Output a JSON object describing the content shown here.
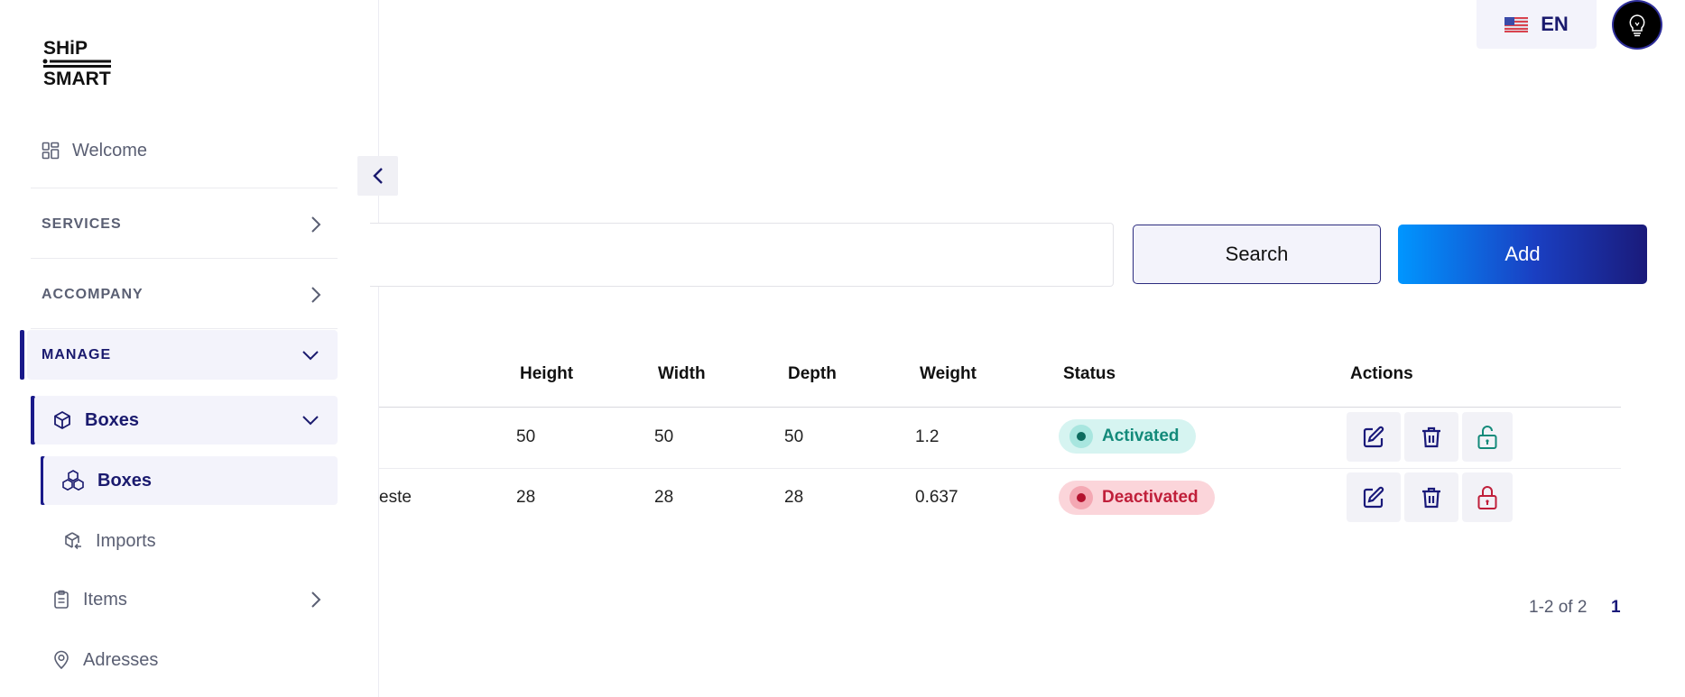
{
  "header": {
    "language": "EN",
    "language_flag": "us-flag-icon",
    "avatar_icon": "lightbulb-icon"
  },
  "sidebar": {
    "logo_text_top": "SHiP",
    "logo_text_bottom": "SMART",
    "welcome": "Welcome",
    "sections": {
      "services": "SERVICES",
      "accompany": "ACCOMPANY",
      "manage": "MANAGE"
    },
    "manage_items": {
      "boxes_parent": "Boxes",
      "boxes_child": "Boxes",
      "imports": "Imports",
      "items": "Items",
      "adresses": "Adresses"
    }
  },
  "toolbar": {
    "search_placeholder": "",
    "search_label": "Search",
    "add_label": "Add"
  },
  "table": {
    "columns": [
      "Height",
      "Width",
      "Depth",
      "Weight",
      "Status",
      "Actions"
    ],
    "rows": [
      {
        "name": "",
        "height": "50",
        "width": "50",
        "depth": "50",
        "weight": "1.2",
        "status": "Activated"
      },
      {
        "name": "este",
        "height": "28",
        "width": "28",
        "depth": "28",
        "weight": "0.637",
        "status": "Deactivated"
      }
    ]
  },
  "pagination": {
    "range_text": "1-2 of 2",
    "current_page": "1"
  },
  "colors": {
    "accent": "#1a1a6e",
    "activated": "#138a7a",
    "deactivated": "#c01f3a"
  }
}
